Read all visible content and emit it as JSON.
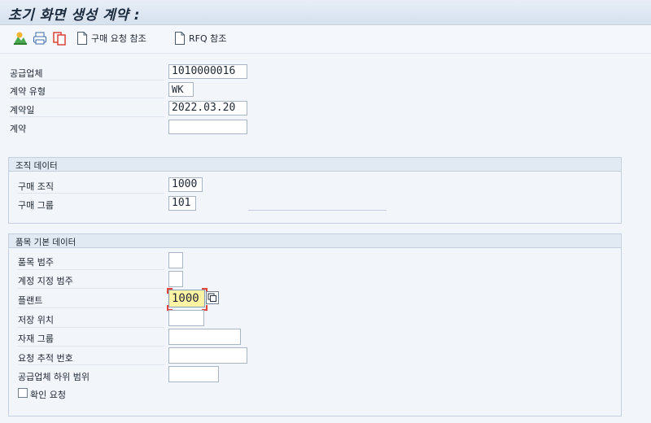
{
  "title": "초기 화면 생성 계약 :",
  "toolbar": {
    "icons": [
      "org-icon",
      "print-icon",
      "copy-icon"
    ],
    "purchase_request_ref": "구매 요청 참조",
    "rfq_ref": "RFQ 참조"
  },
  "header_fields": [
    {
      "label": "공급업체",
      "value": "1010000016"
    },
    {
      "label": "계약 유형",
      "value": "WK"
    },
    {
      "label": "계약일",
      "value": "2022.03.20"
    },
    {
      "label": "계약",
      "value": ""
    }
  ],
  "org_group": {
    "title": "조직 데이터",
    "fields": [
      {
        "label": "구매 조직",
        "value": "1000"
      },
      {
        "label": "구매 그룹",
        "value": "101"
      }
    ]
  },
  "item_group": {
    "title": "품목 기본 데이터",
    "fields": [
      {
        "label": "품목 범주",
        "value": ""
      },
      {
        "label": "계정 지정 범주",
        "value": ""
      },
      {
        "label": "플랜트",
        "value": "1000"
      },
      {
        "label": "저장 위치",
        "value": ""
      },
      {
        "label": "자재 그룹",
        "value": ""
      },
      {
        "label": "요청 추적 번호",
        "value": ""
      },
      {
        "label": "공급업체 하위 범위",
        "value": ""
      }
    ],
    "confirm_label": "확인 요청"
  },
  "colors": {
    "accent": "#e0463b",
    "highlight": "#fff4a3",
    "group_header": "#e1e9f3"
  }
}
